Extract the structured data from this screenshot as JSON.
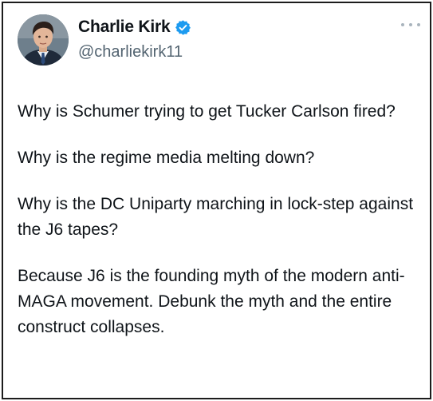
{
  "user": {
    "name": "Charlie Kirk",
    "handle": "@charliekirk11",
    "verified_color": "#1d9bf0"
  },
  "icons": {
    "avatar": "profile-photo",
    "verified": "verified-badge-icon",
    "more": "more-options-icon"
  },
  "tweet": {
    "paragraphs": [
      "Why is Schumer trying to get Tucker Carlson fired?",
      "Why is the regime media melting down?",
      "Why is the DC Uniparty marching in lock-step against the J6 tapes?",
      "Because J6 is the founding myth of the modern anti-MAGA movement. Debunk the myth and the entire construct collapses."
    ]
  }
}
